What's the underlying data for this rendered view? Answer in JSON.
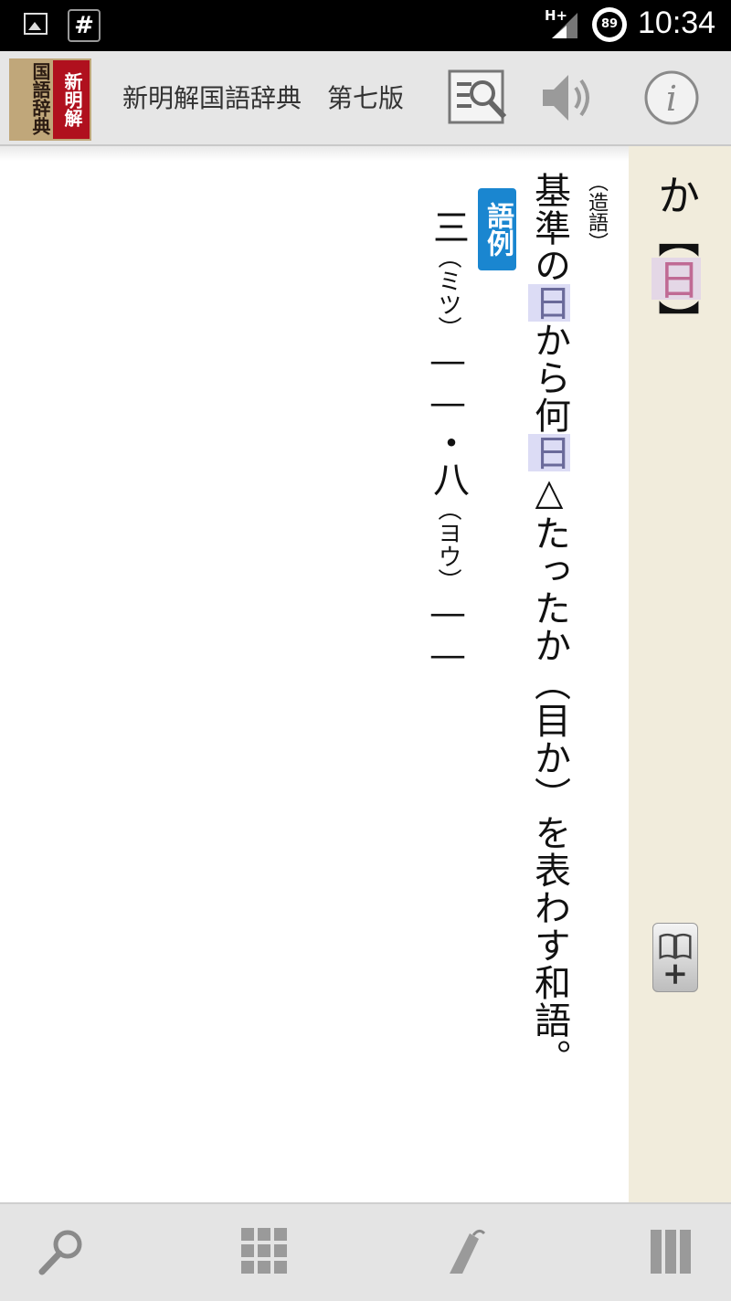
{
  "status_bar": {
    "network": "H+",
    "battery": "89",
    "time": "10:34"
  },
  "header": {
    "logo_text_left": "国語辞典",
    "logo_text_right": "新明解",
    "title": "新明解国語辞典　第七版",
    "icons": [
      "search-list-icon",
      "speaker-icon",
      "info-icon"
    ]
  },
  "entry": {
    "headword_kana": "か",
    "headword_open": "【",
    "headword_kanji": "日",
    "headword_close": "】",
    "tag": "（造語）",
    "definition_parts": [
      "基準の",
      "日",
      "から何",
      "日",
      "△たったか（目か）を表わす和語。"
    ],
    "example_badge": "語例",
    "example_parts": [
      "三",
      "（ミツ）",
      "——・八",
      "（ヨウ）",
      "——"
    ]
  },
  "bottom_bar": {
    "icons": [
      "search-icon",
      "grid-icon",
      "bookmark-tag-icon",
      "columns-icon"
    ]
  },
  "colors": {
    "accent_blue": "#1a86d0",
    "highlight": "#dcdcf5",
    "headword_kanji": "#c06a94",
    "strip_bg": "#f1ecdc"
  }
}
